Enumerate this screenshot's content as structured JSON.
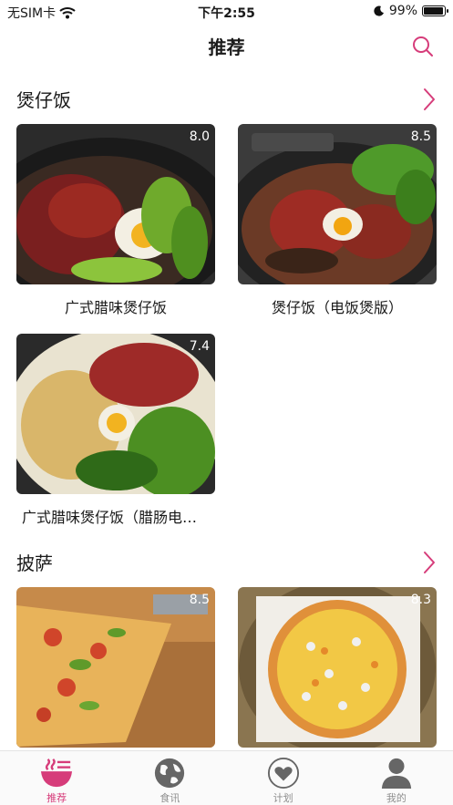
{
  "status_bar": {
    "carrier": "无SIM卡",
    "time": "下午2:55",
    "battery": "99%",
    "battery_level": 0.99
  },
  "nav": {
    "title": "推荐"
  },
  "colors": {
    "accent": "#d63c7a",
    "inactive": "#8e8e8e"
  },
  "sections": [
    {
      "title": "煲仔饭",
      "items": [
        {
          "name": "广式腊味煲仔饭",
          "score": "8.0"
        },
        {
          "name": "煲仔饭（电饭煲版）",
          "score": "8.5"
        },
        {
          "name": "广式腊味煲仔饭（腊肠电…",
          "score": "7.4"
        }
      ]
    },
    {
      "title": "披萨",
      "items": [
        {
          "name": "",
          "score": "8.5"
        },
        {
          "name": "",
          "score": "8.3"
        }
      ]
    }
  ],
  "tabbar": {
    "items": [
      {
        "label": "推荐",
        "icon": "bowl-icon",
        "active": true
      },
      {
        "label": "食讯",
        "icon": "globe-icon",
        "active": false
      },
      {
        "label": "计划",
        "icon": "heart-icon",
        "active": false
      },
      {
        "label": "我的",
        "icon": "user-icon",
        "active": false
      }
    ]
  }
}
